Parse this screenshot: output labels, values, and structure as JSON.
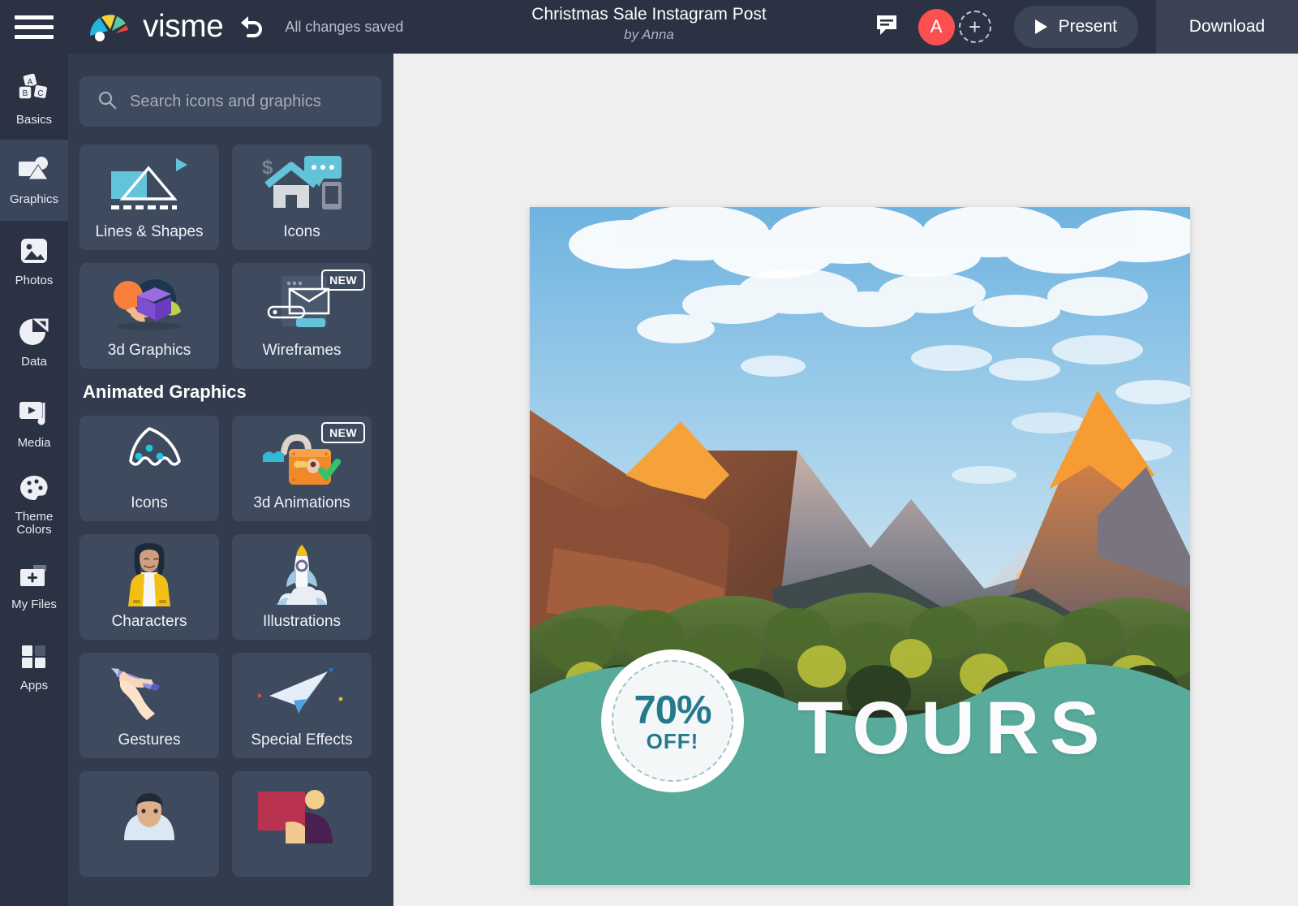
{
  "topbar": {
    "menu_icon": "hamburger-icon",
    "logo_text": "visme",
    "undo_icon": "undo-icon",
    "save_status": "All changes saved",
    "doc_title": "Christmas Sale Instagram Post",
    "doc_author": "by Anna",
    "comment_icon": "comment-icon",
    "avatar_initial": "A",
    "add_collaborator_icon": "plus-icon",
    "present_label": "Present",
    "present_icon": "play-icon",
    "download_label": "Download",
    "accent_color": "#fc4f4f",
    "bar_color": "#2b3244"
  },
  "rail": {
    "items": [
      {
        "label": "Basics",
        "icon": "abc-blocks-icon",
        "active": false
      },
      {
        "label": "Graphics",
        "icon": "graphics-shapes-icon",
        "active": true
      },
      {
        "label": "Photos",
        "icon": "photo-icon",
        "active": false
      },
      {
        "label": "Data",
        "icon": "pie-chart-icon",
        "active": false
      },
      {
        "label": "Media",
        "icon": "media-play-icon",
        "active": false
      },
      {
        "label": "Theme Colors",
        "icon": "palette-icon",
        "active": false
      },
      {
        "label": "My Files",
        "icon": "folder-plus-icon",
        "active": false
      },
      {
        "label": "Apps",
        "icon": "apps-grid-icon",
        "active": false
      }
    ]
  },
  "panel": {
    "search": {
      "placeholder": "Search icons and graphics",
      "icon": "search-icon",
      "value": ""
    },
    "top_cards": [
      {
        "label": "Lines & Shapes",
        "art": "lines-shapes-art",
        "badge": ""
      },
      {
        "label": "Icons",
        "art": "icons-art",
        "badge": ""
      },
      {
        "label": "3d Graphics",
        "art": "3d-graphics-art",
        "badge": ""
      },
      {
        "label": "Wireframes",
        "art": "wireframes-art",
        "badge": "NEW"
      }
    ],
    "section_title": "Animated Graphics",
    "animated_cards": [
      {
        "label": "Icons",
        "art": "animated-pizza-icon-art",
        "badge": ""
      },
      {
        "label": "3d Animations",
        "art": "padlock-art",
        "badge": "NEW"
      },
      {
        "label": "Characters",
        "art": "character-woman-art",
        "badge": ""
      },
      {
        "label": "Illustrations",
        "art": "rocket-art",
        "badge": ""
      },
      {
        "label": "Gestures",
        "art": "hand-pen-art",
        "badge": ""
      },
      {
        "label": "Special Effects",
        "art": "paper-plane-art",
        "badge": ""
      },
      {
        "label": "",
        "art": "man-portrait-art",
        "badge": ""
      },
      {
        "label": "",
        "art": "abstract-shapes-art",
        "badge": ""
      }
    ]
  },
  "canvas": {
    "photo_alt": "mountain-landscape-photo",
    "wave_color": "#58ab9a",
    "badge_percent": "70%",
    "badge_off": "OFF!",
    "badge_text_color": "#26798c",
    "headline": "TOURS",
    "headline_color": "#fbfbfd"
  }
}
